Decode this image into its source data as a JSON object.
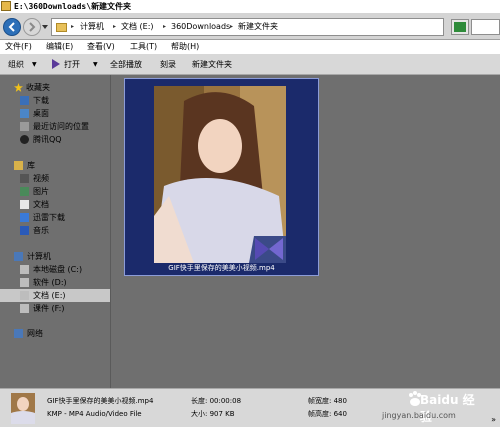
{
  "window": {
    "title": "E:\\360Downloads\\新建文件夹"
  },
  "address": {
    "crumbs": [
      "计算机",
      "文档 (E:)",
      "360Downloads",
      "新建文件夹"
    ],
    "separator": "▸"
  },
  "menu": [
    "文件(F)",
    "编辑(E)",
    "查看(V)",
    "工具(T)",
    "帮助(H)"
  ],
  "commands": {
    "organize": "组织",
    "open": "打开",
    "play_all": "全部播放",
    "burn": "刻录",
    "new_folder": "新建文件夹",
    "arrow": "▼"
  },
  "sidebar": {
    "favorites": {
      "label": "收藏夹",
      "items": [
        "下载",
        "桌面",
        "最近访问的位置",
        "腾讯QQ"
      ]
    },
    "libraries": {
      "label": "库",
      "items": [
        "视频",
        "图片",
        "文档",
        "迅雷下载",
        "音乐"
      ]
    },
    "computer": {
      "label": "计算机",
      "items": [
        "本地磁盘 (C:)",
        "软件 (D:)",
        "文档 (E:)",
        "课件 (F:)"
      ],
      "selected": "文档 (E:)"
    },
    "network": {
      "label": "网络"
    }
  },
  "files": [
    {
      "name": "GIF快手里保存的美美小视频.mp4"
    }
  ],
  "details": {
    "filename": "GIF快手里保存的美美小视频.mp4",
    "filetype": "KMP - MP4 Audio/Video File",
    "length": "长度: 00:00:08",
    "size": "大小: 907 KB",
    "frame_width": "帧宽度: 480",
    "frame_height": "帧高度: 640",
    "more": "»"
  },
  "watermark": {
    "brand": "Baidu 经验",
    "url": "jingyan.baidu.com"
  },
  "colors": {
    "selection": "#1b2a6b",
    "background": "#6f6f6f",
    "toolbar": "#d8d8d8"
  }
}
